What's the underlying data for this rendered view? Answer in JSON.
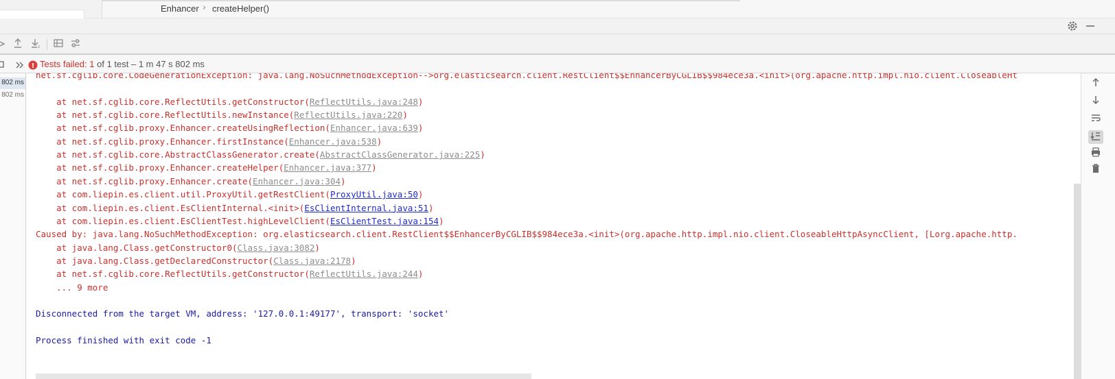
{
  "breadcrumb": [
    "Enhancer",
    "createHelper()"
  ],
  "breadcrumb_sep": "›",
  "title_bar": {
    "settings_icon": "gear-icon",
    "minimize_icon": "minimize-icon"
  },
  "toolbar": {
    "icons": [
      "expand-icon",
      "export-up-icon",
      "import-down-icon",
      "grid-icon",
      "settings-sliders-icon"
    ]
  },
  "status": {
    "prefix_icon": "double-chevron-right-icon",
    "fail_icon": "error-circle-icon",
    "failed_label": "Tests failed: 1",
    "detail": "of 1 test – 1 m 47 s 802 ms"
  },
  "tree": {
    "durations": [
      "802 ms",
      "802 ms"
    ]
  },
  "console": {
    "lines": [
      {
        "kind": "err",
        "parts": [
          {
            "t": "net.sf.cglib.core.CodeGenerationException: java.lang.NoSuchMethodException-->org.elasticsearch.client.RestClient$$EnhancerByCGLIB$$984ece3a.<init>(org.apache.http.impl.nio.client.CloseableHt"
          }
        ]
      },
      {
        "kind": "blank",
        "parts": []
      },
      {
        "kind": "err",
        "parts": [
          {
            "t": "    at net.sf.cglib.core.ReflectUtils.getConstructor("
          },
          {
            "t": "ReflectUtils.java:248",
            "link": "gray"
          },
          {
            "t": ")"
          }
        ]
      },
      {
        "kind": "err",
        "parts": [
          {
            "t": "    at net.sf.cglib.core.ReflectUtils.newInstance("
          },
          {
            "t": "ReflectUtils.java:220",
            "link": "gray"
          },
          {
            "t": ")"
          }
        ]
      },
      {
        "kind": "err",
        "parts": [
          {
            "t": "    at net.sf.cglib.proxy.Enhancer.createUsingReflection("
          },
          {
            "t": "Enhancer.java:639",
            "link": "gray"
          },
          {
            "t": ")"
          }
        ]
      },
      {
        "kind": "err",
        "parts": [
          {
            "t": "    at net.sf.cglib.proxy.Enhancer.firstInstance("
          },
          {
            "t": "Enhancer.java:538",
            "link": "gray"
          },
          {
            "t": ")"
          }
        ]
      },
      {
        "kind": "err",
        "parts": [
          {
            "t": "    at net.sf.cglib.core.AbstractClassGenerator.create("
          },
          {
            "t": "AbstractClassGenerator.java:225",
            "link": "gray"
          },
          {
            "t": ")"
          }
        ]
      },
      {
        "kind": "err",
        "parts": [
          {
            "t": "    at net.sf.cglib.proxy.Enhancer.createHelper("
          },
          {
            "t": "Enhancer.java:377",
            "link": "gray"
          },
          {
            "t": ")"
          }
        ]
      },
      {
        "kind": "err",
        "parts": [
          {
            "t": "    at net.sf.cglib.proxy.Enhancer.create("
          },
          {
            "t": "Enhancer.java:304",
            "link": "gray"
          },
          {
            "t": ")"
          }
        ]
      },
      {
        "kind": "err",
        "parts": [
          {
            "t": "    at com.liepin.es.client.util.ProxyUtil.getRestClient("
          },
          {
            "t": "ProxyUtil.java:50",
            "link": "blue"
          },
          {
            "t": ")"
          }
        ]
      },
      {
        "kind": "err",
        "parts": [
          {
            "t": "    at com.liepin.es.client.EsClientInternal.<init>("
          },
          {
            "t": "EsClientInternal.java:51",
            "link": "blue"
          },
          {
            "t": ")"
          }
        ]
      },
      {
        "kind": "err",
        "parts": [
          {
            "t": "    at com.liepin.es.client.EsClientTest.highLevelClient("
          },
          {
            "t": "EsClientTest.java:154",
            "link": "blue"
          },
          {
            "t": ")"
          }
        ]
      },
      {
        "kind": "err",
        "parts": [
          {
            "t": "Caused by: java.lang.NoSuchMethodException: org.elasticsearch.client.RestClient$$EnhancerByCGLIB$$984ece3a.<init>(org.apache.http.impl.nio.client.CloseableHttpAsyncClient, [Lorg.apache.http."
          }
        ]
      },
      {
        "kind": "err",
        "parts": [
          {
            "t": "    at java.lang.Class.getConstructor0("
          },
          {
            "t": "Class.java:3082",
            "link": "gray"
          },
          {
            "t": ")"
          }
        ]
      },
      {
        "kind": "err",
        "parts": [
          {
            "t": "    at java.lang.Class.getDeclaredConstructor("
          },
          {
            "t": "Class.java:2178",
            "link": "gray"
          },
          {
            "t": ")"
          }
        ]
      },
      {
        "kind": "err",
        "parts": [
          {
            "t": "    at net.sf.cglib.core.ReflectUtils.getConstructor("
          },
          {
            "t": "ReflectUtils.java:244",
            "link": "gray"
          },
          {
            "t": ")"
          }
        ]
      },
      {
        "kind": "err",
        "parts": [
          {
            "t": "    ... 9 more"
          }
        ]
      },
      {
        "kind": "blank",
        "parts": []
      },
      {
        "kind": "blue",
        "parts": [
          {
            "t": "Disconnected from the target VM, address: '127.0.0.1:49177', transport: 'socket'"
          }
        ]
      },
      {
        "kind": "blank",
        "parts": []
      },
      {
        "kind": "blue",
        "parts": [
          {
            "t": "Process finished with exit code -1"
          }
        ]
      }
    ]
  },
  "gutter_icons": [
    "arrow-up-icon",
    "arrow-down-icon",
    "soft-wrap-icon",
    "scroll-to-end-icon",
    "print-icon",
    "trash-icon"
  ],
  "colors": {
    "error": "#c8302c",
    "info": "#1a1aa6",
    "link": "#1f2bd0"
  }
}
